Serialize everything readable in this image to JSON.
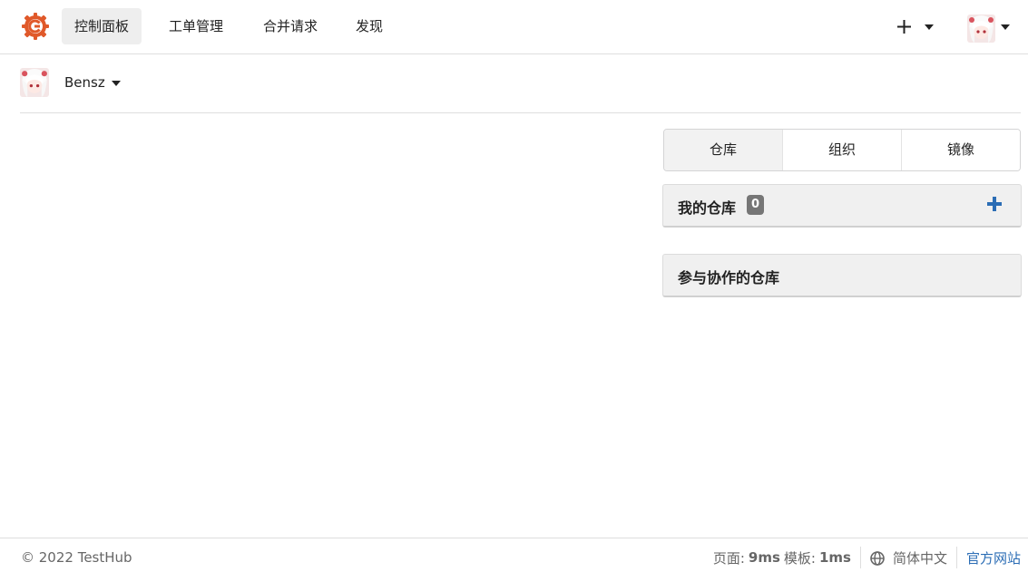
{
  "nav": {
    "items": [
      {
        "label": "控制面板",
        "active": true
      },
      {
        "label": "工单管理",
        "active": false
      },
      {
        "label": "合并请求",
        "active": false
      },
      {
        "label": "发现",
        "active": false
      }
    ],
    "plus_icon": "plus-icon",
    "avatar_icon": "avatar"
  },
  "context": {
    "username": "Bensz"
  },
  "tabs": [
    {
      "label": "仓库",
      "active": true
    },
    {
      "label": "组织",
      "active": false
    },
    {
      "label": "镜像",
      "active": false
    }
  ],
  "panels": {
    "my_repos": {
      "title": "我的仓库",
      "count": "0"
    },
    "collab_repos": {
      "title": "参与协作的仓库"
    }
  },
  "footer": {
    "copyright": "© 2022 TestHub",
    "page_label": "页面:",
    "page_time": "9ms",
    "template_label": "模板:",
    "template_time": "1ms",
    "language": "简体中文",
    "official_site": "官方网站"
  },
  "colors": {
    "brand": "#e0592a",
    "link": "#2b6db5",
    "add_icon": "#2b6db5",
    "badge": "#767676"
  }
}
